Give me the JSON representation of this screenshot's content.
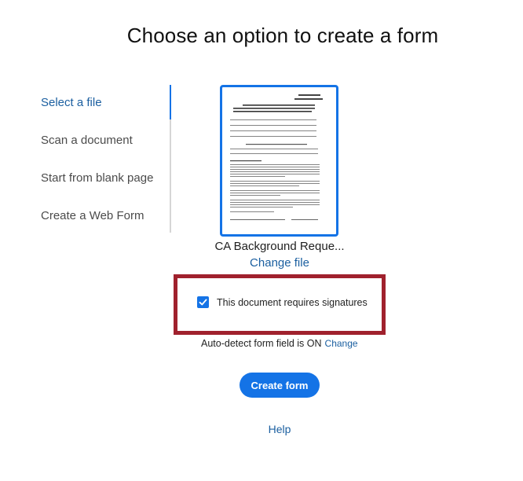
{
  "page": {
    "title": "Choose an option to create a form"
  },
  "nav": {
    "items": [
      {
        "label": "Select a file",
        "active": true
      },
      {
        "label": "Scan a document",
        "active": false
      },
      {
        "label": "Start from blank page",
        "active": false
      },
      {
        "label": "Create a Web Form",
        "active": false
      }
    ]
  },
  "file": {
    "name": "CA Background Reque...",
    "change_label": "Change file"
  },
  "signature": {
    "checked": true,
    "label": "This document requires signatures"
  },
  "auto_detect": {
    "text": "Auto-detect form field is ON",
    "change_label": "Change"
  },
  "actions": {
    "create_label": "Create form"
  },
  "help": {
    "label": "Help"
  },
  "colors": {
    "accent": "#1473e6",
    "link": "#1b5fa0",
    "highlight": "#a0212d"
  },
  "icons": {
    "checkbox": "checkmark-icon"
  }
}
